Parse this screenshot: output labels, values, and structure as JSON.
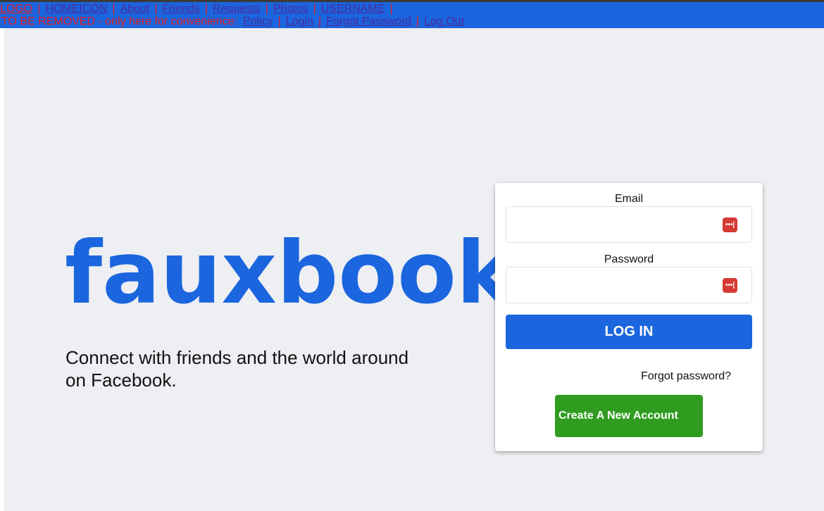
{
  "nav": {
    "row1": [
      {
        "label": "LOGO"
      },
      {
        "label": "HOMEICON"
      },
      {
        "label": "About"
      },
      {
        "label": "Friends"
      },
      {
        "label": "Requests"
      },
      {
        "label": "Photos"
      },
      {
        "label": "USERNAME"
      }
    ],
    "separator": "|",
    "notice": "TO BE REMOVED - only here for convenience:",
    "row2": [
      {
        "label": "Policy"
      },
      {
        "label": "Login"
      },
      {
        "label": "Forgot Password"
      },
      {
        "label": "Log Out"
      }
    ]
  },
  "brand": {
    "name": "fauxbook",
    "tagline": "Connect with friends and the world around on Facebook."
  },
  "login_form": {
    "email_label": "Email",
    "email_value": "",
    "password_label": "Password",
    "password_value": "",
    "password_manager_icon": "•••|",
    "login_button": "LOG IN",
    "forgot_link": "Forgot password?",
    "create_button": "Create A New Account"
  },
  "colors": {
    "nav_bg": "#1b65de",
    "brand": "#1b65de",
    "page_bg": "#edeff3",
    "create_button": "#2f9c20",
    "warning_text": "#e31c1c"
  }
}
